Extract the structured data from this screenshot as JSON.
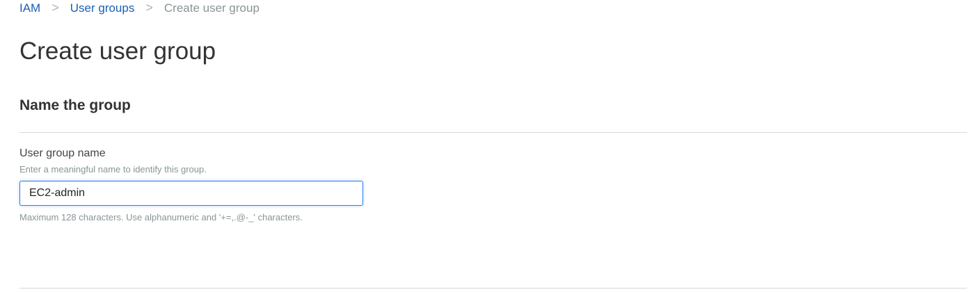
{
  "breadcrumb": {
    "items": [
      "IAM",
      "User groups"
    ],
    "current": "Create user group",
    "separator": ">"
  },
  "page_title": "Create user group",
  "section": {
    "title": "Name the group",
    "field": {
      "label": "User group name",
      "description": "Enter a meaningful name to identify this group.",
      "value": "EC2-admin",
      "constraint": "Maximum 128 characters. Use alphanumeric and '+=,.@-_' characters."
    }
  }
}
